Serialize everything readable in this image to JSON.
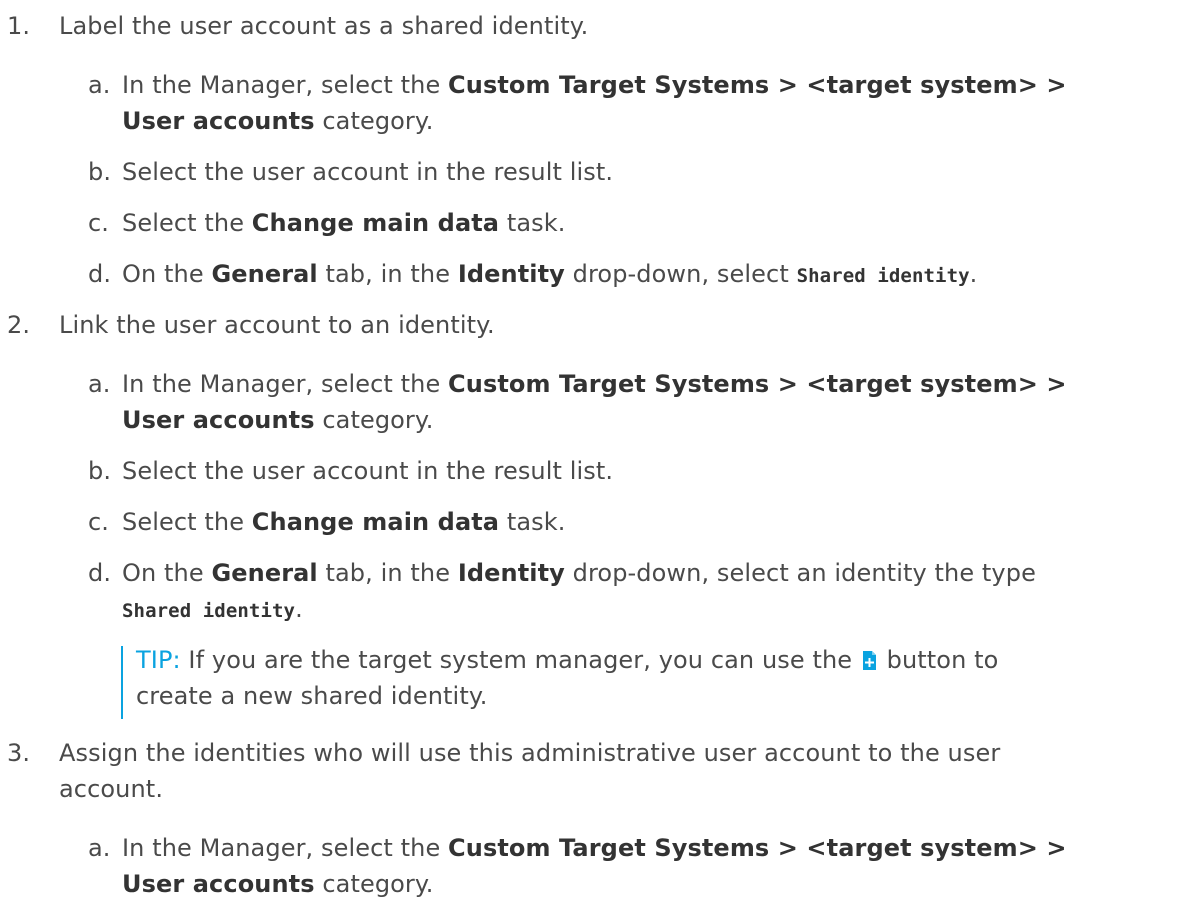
{
  "steps": [
    {
      "number": "1.",
      "text": "Label the user account as a shared identity.",
      "substeps": [
        {
          "letter": "a.",
          "pre": "In the Manager, select the ",
          "bold": "Custom Target Systems > <target system> >",
          "bold2": "User accounts",
          "post": " category."
        },
        {
          "letter": "b.",
          "text": "Select the user account in the result list."
        },
        {
          "letter": "c.",
          "pre": "Select the ",
          "bold": "Change main data",
          "post": " task."
        },
        {
          "letter": "d.",
          "pre": "On the ",
          "bold1": "General",
          "mid1": " tab, in the ",
          "bold2": "Identity",
          "mid2": " drop-down, select ",
          "code": "Shared identity",
          "post": "."
        }
      ]
    },
    {
      "number": "2.",
      "text": "Link the user account to an identity.",
      "substeps": [
        {
          "letter": "a.",
          "pre": "In the Manager, select the ",
          "bold": "Custom Target Systems > <target system> >",
          "bold2": "User accounts",
          "post": " category."
        },
        {
          "letter": "b.",
          "text": "Select the user account in the result list."
        },
        {
          "letter": "c.",
          "pre": "Select the ",
          "bold": "Change main data",
          "post": " task."
        },
        {
          "letter": "d.",
          "pre": "On the ",
          "bold1": "General",
          "mid1": " tab, in the ",
          "bold2": "Identity",
          "mid2": " drop-down, select an identity the type",
          "code": "Shared identity",
          "post": "."
        }
      ],
      "tip": {
        "label": "TIP:",
        "text1": " If you are the target system manager, you can use the ",
        "text2": " button to",
        "text3": "create a new shared identity."
      }
    },
    {
      "number": "3.",
      "text_line1": "Assign the identities who will use this administrative user account to the user",
      "text_line2": "account.",
      "substeps": [
        {
          "letter": "a.",
          "pre": "In the Manager, select the ",
          "bold": "Custom Target Systems > <target system> >",
          "bold2": "User accounts",
          "post": " category."
        }
      ]
    }
  ],
  "icons": {
    "add": "add-document-icon",
    "accent": "#0aa3e0"
  }
}
